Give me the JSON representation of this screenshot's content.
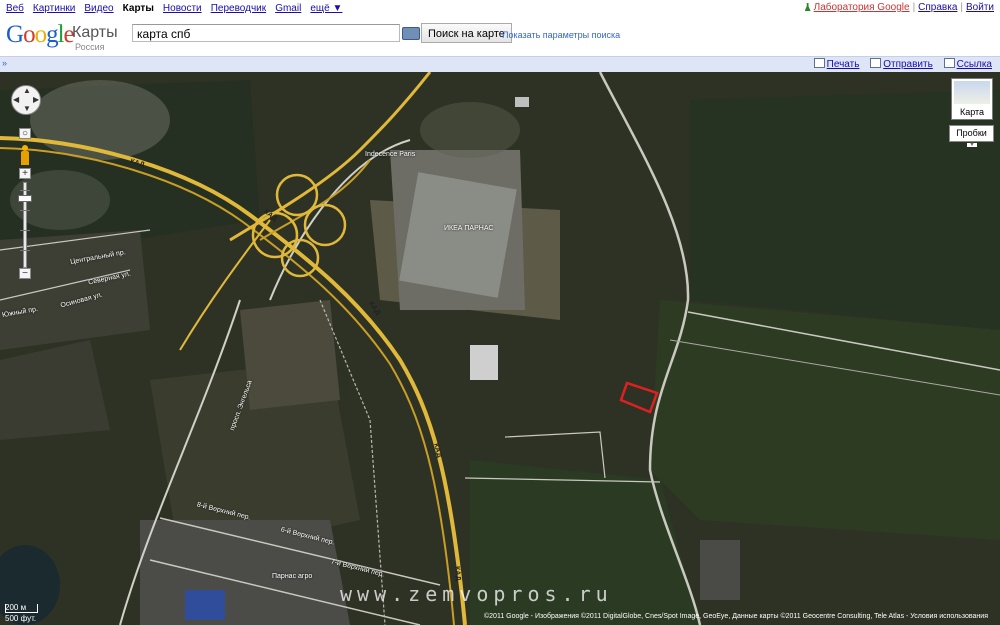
{
  "topnav": {
    "links": [
      "Веб",
      "Картинки",
      "Видео",
      "Карты",
      "Новости",
      "Переводчик",
      "Gmail",
      "ещё ▼"
    ],
    "right": {
      "labs": "Лаборатория Google",
      "help": "Справка",
      "signin": "Войти"
    }
  },
  "header": {
    "logo": "Google",
    "product": "Карты",
    "country": "Россия",
    "search_value": "карта спб",
    "search_button": "Поиск на карте",
    "search_options": "Показать параметры поиска"
  },
  "toolbar": {
    "collapse": "»",
    "print": "Печать",
    "send": "Отправить",
    "link": "Ссылка"
  },
  "map": {
    "type_button": "Карта",
    "traffic_button": "Пробки",
    "scale_metric": "200 м",
    "scale_imperial": "500 фут.",
    "copyright": "©2011 Google - Изображения ©2011 DigitalGlobe, Cnes/Spot Image, GeoEye, Данные карты ©2011 Geocentre Consulting, Tele Atlas - Условия использования",
    "watermark": "www.zemvopros.ru",
    "labels": {
      "ikea": "ИКЕА ПАРНАС",
      "indecence": "Indecence Paris",
      "parnas": "Парнас агро",
      "kad1": "КАД",
      "kad2": "КАД",
      "kad3": "КАД",
      "kad4": "КАД",
      "kad5": "КАД",
      "central": "Центральный пр.",
      "yuzhny": "Южный пр.",
      "osinovaya": "Осиновая ул.",
      "severny": "Северная ул.",
      "verkhny1": "8-й Верхний пер.",
      "verkhny2": "6-й Верхний пер.",
      "verkhny3": "7-й Верхний пер.",
      "engels": "просп. Энгельса"
    }
  }
}
